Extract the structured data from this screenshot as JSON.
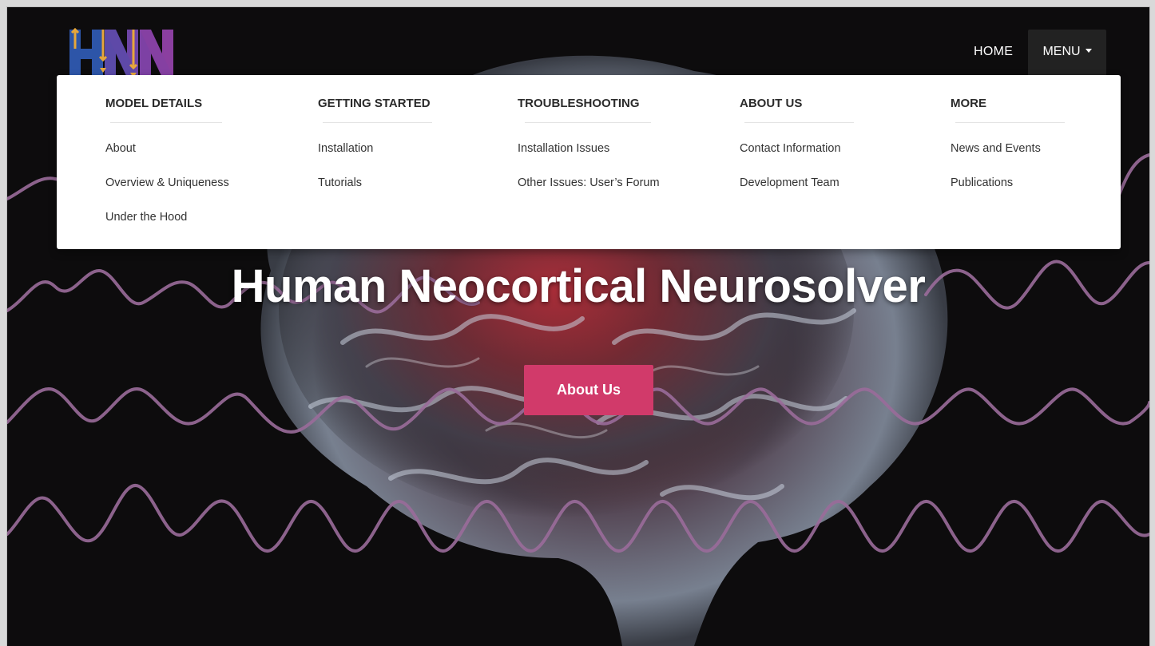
{
  "nav": {
    "logo_alt": "HNN",
    "home_label": "HOME",
    "menu_label": "MENU"
  },
  "mega_menu": {
    "columns": [
      {
        "heading": "MODEL DETAILS",
        "links": [
          "About",
          "Overview & Uniqueness",
          "Under the Hood"
        ]
      },
      {
        "heading": "GETTING STARTED",
        "links": [
          "Installation",
          "Tutorials"
        ]
      },
      {
        "heading": "TROUBLESHOOTING",
        "links": [
          "Installation Issues",
          "Other Issues: User’s Forum"
        ]
      },
      {
        "heading": "ABOUT US",
        "links": [
          "Contact Information",
          "Development Team"
        ]
      },
      {
        "heading": "MORE",
        "links": [
          "News and Events",
          "Publications"
        ]
      }
    ]
  },
  "hero": {
    "title": "Human Neocortical Neurosolver",
    "cta_label": "About Us"
  },
  "colors": {
    "background": "#0d0c0d",
    "cta": "#d13a6a",
    "wave": "#9a6c9a",
    "logo_blue": "#2d55a8",
    "logo_purple": "#8b3fa0",
    "logo_gold": "#e8a73a"
  }
}
